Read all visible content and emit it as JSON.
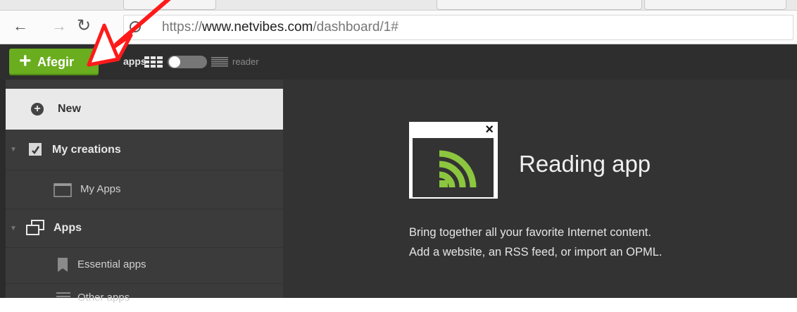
{
  "browser": {
    "back_icon": "back-arrow-icon",
    "forward_icon": "forward-arrow-icon",
    "reload_icon": "reload-icon",
    "url_scheme": "https://",
    "url_domain": "www.netvibes.com",
    "url_path": "/dashboard/1#"
  },
  "header": {
    "add_label": "Afegir",
    "view_apps_label": "apps",
    "view_reader_label": "reader",
    "accent_color": "#6aad1f"
  },
  "sidebar": {
    "new_label": "New",
    "sections": [
      {
        "label": "My creations",
        "icon": "creations-icon",
        "children": [
          {
            "label": "My Apps",
            "icon": "window-icon"
          }
        ]
      },
      {
        "label": "Apps",
        "icon": "apps-windows-icon",
        "children": [
          {
            "label": "Essential apps",
            "icon": "bookmark-icon"
          },
          {
            "label": "Other apps",
            "icon": "list-icon"
          }
        ]
      }
    ]
  },
  "main": {
    "app_title": "Reading app",
    "app_icon": "rss-feed-icon",
    "close_symbol": "×",
    "description_line1": "Bring together all your favorite Internet content.",
    "description_line2": "Add a website, an RSS feed, or import an OPML.",
    "rss_color": "#8cc63f"
  }
}
